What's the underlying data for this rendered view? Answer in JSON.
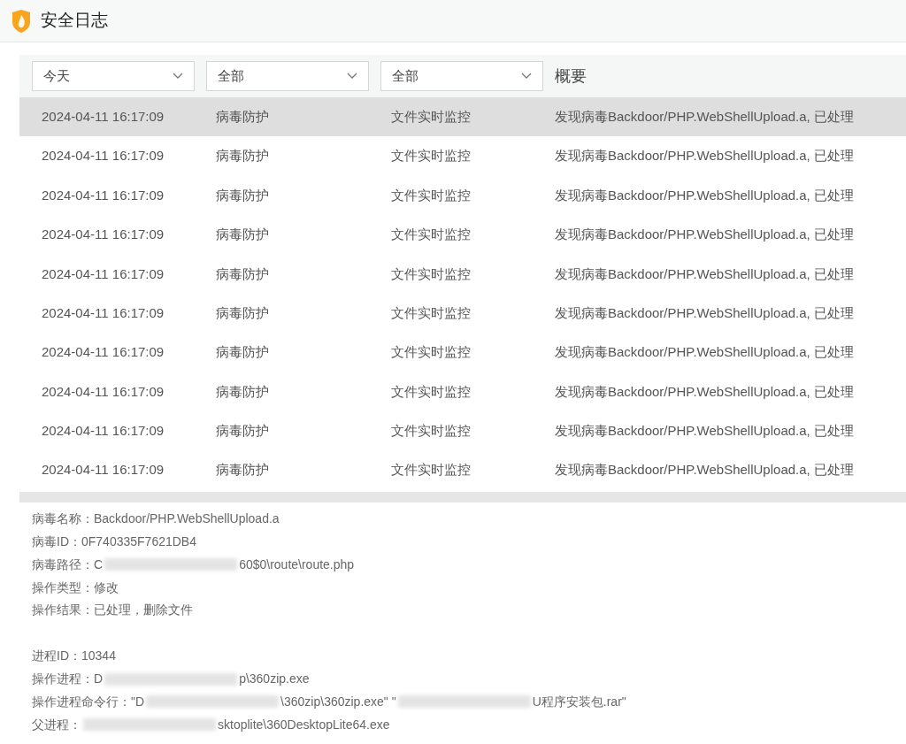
{
  "window": {
    "title": "安全日志"
  },
  "filters": [
    {
      "value": "今天"
    },
    {
      "value": "全部"
    },
    {
      "value": "全部"
    }
  ],
  "summary_heading": "概要",
  "rows": [
    {
      "time": "2024-04-11 16:17:09",
      "category": "病毒防护",
      "source": "文件实时监控",
      "summary": "发现病毒Backdoor/PHP.WebShellUpload.a, 已处理",
      "selected": true
    },
    {
      "time": "2024-04-11 16:17:09",
      "category": "病毒防护",
      "source": "文件实时监控",
      "summary": "发现病毒Backdoor/PHP.WebShellUpload.a, 已处理",
      "selected": false
    },
    {
      "time": "2024-04-11 16:17:09",
      "category": "病毒防护",
      "source": "文件实时监控",
      "summary": "发现病毒Backdoor/PHP.WebShellUpload.a, 已处理",
      "selected": false
    },
    {
      "time": "2024-04-11 16:17:09",
      "category": "病毒防护",
      "source": "文件实时监控",
      "summary": "发现病毒Backdoor/PHP.WebShellUpload.a, 已处理",
      "selected": false
    },
    {
      "time": "2024-04-11 16:17:09",
      "category": "病毒防护",
      "source": "文件实时监控",
      "summary": "发现病毒Backdoor/PHP.WebShellUpload.a, 已处理",
      "selected": false
    },
    {
      "time": "2024-04-11 16:17:09",
      "category": "病毒防护",
      "source": "文件实时监控",
      "summary": "发现病毒Backdoor/PHP.WebShellUpload.a, 已处理",
      "selected": false
    },
    {
      "time": "2024-04-11 16:17:09",
      "category": "病毒防护",
      "source": "文件实时监控",
      "summary": "发现病毒Backdoor/PHP.WebShellUpload.a, 已处理",
      "selected": false
    },
    {
      "time": "2024-04-11 16:17:09",
      "category": "病毒防护",
      "source": "文件实时监控",
      "summary": "发现病毒Backdoor/PHP.WebShellUpload.a, 已处理",
      "selected": false
    },
    {
      "time": "2024-04-11 16:17:09",
      "category": "病毒防护",
      "source": "文件实时监控",
      "summary": "发现病毒Backdoor/PHP.WebShellUpload.a, 已处理",
      "selected": false
    },
    {
      "time": "2024-04-11 16:17:09",
      "category": "病毒防护",
      "source": "文件实时监控",
      "summary": "发现病毒Backdoor/PHP.WebShellUpload.a, 已处理",
      "selected": false
    }
  ],
  "details": [
    {
      "label": "病毒名称：",
      "segments": [
        {
          "kind": "text",
          "text": "Backdoor/PHP.WebShellUpload.a"
        }
      ]
    },
    {
      "label": "病毒ID：",
      "segments": [
        {
          "kind": "text",
          "text": "0F740335F7621DB4"
        }
      ]
    },
    {
      "label": "病毒路径：",
      "segments": [
        {
          "kind": "text",
          "text": "C"
        },
        {
          "kind": "redacted"
        },
        {
          "kind": "text",
          "text": "60$0\\route\\route.php"
        }
      ]
    },
    {
      "label": "操作类型：",
      "segments": [
        {
          "kind": "text",
          "text": "修改"
        }
      ]
    },
    {
      "label": "操作结果：",
      "segments": [
        {
          "kind": "text",
          "text": "已处理，删除文件"
        }
      ]
    },
    {
      "kind": "spacer"
    },
    {
      "label": "进程ID：",
      "segments": [
        {
          "kind": "text",
          "text": "10344"
        }
      ]
    },
    {
      "label": "操作进程：",
      "segments": [
        {
          "kind": "text",
          "text": "D"
        },
        {
          "kind": "redacted"
        },
        {
          "kind": "text",
          "text": "p\\360zip.exe"
        }
      ]
    },
    {
      "label": "操作进程命令行：",
      "segments": [
        {
          "kind": "text",
          "text": "\"D"
        },
        {
          "kind": "redacted"
        },
        {
          "kind": "text",
          "text": "\\360zip\\360zip.exe\" \""
        },
        {
          "kind": "redacted"
        },
        {
          "kind": "text",
          "text": "U程序安装包.rar\""
        }
      ]
    },
    {
      "label": "父进程：",
      "segments": [
        {
          "kind": "redacted"
        },
        {
          "kind": "text",
          "text": "sktoplite\\360DesktopLite64.exe"
        }
      ]
    }
  ]
}
